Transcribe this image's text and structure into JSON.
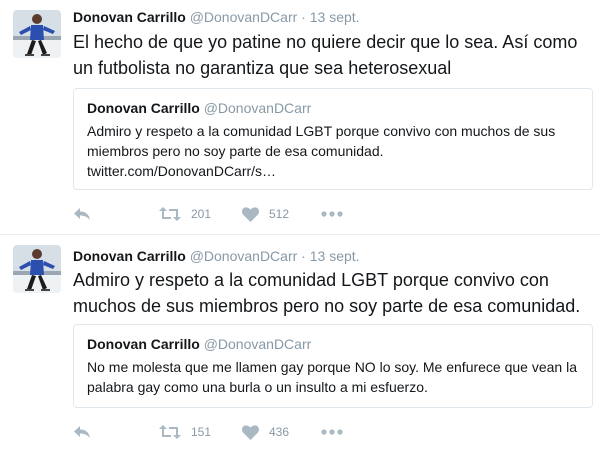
{
  "tweets": [
    {
      "name": "Donovan Carrillo",
      "handle": "@DonovanDCarr",
      "separator": "·",
      "time": "13 sept.",
      "text": "El hecho de que yo patine no quiere decir que lo sea. Así como un futbolista no garantiza que sea heterosexual",
      "quote": {
        "name": "Donovan Carrillo",
        "handle": "@DonovanDCarr",
        "text": "Admiro y respeto a la comunidad LGBT porque convivo con muchos de sus miembros pero no soy parte de esa comunidad.",
        "link": "twitter.com/DonovanDCarr/s…"
      },
      "retweets": "201",
      "likes": "512"
    },
    {
      "name": "Donovan Carrillo",
      "handle": "@DonovanDCarr",
      "separator": "·",
      "time": "13 sept.",
      "text": "Admiro y respeto a la comunidad LGBT porque convivo con muchos de sus miembros pero no soy parte de esa comunidad.",
      "quote": {
        "name": "Donovan Carrillo",
        "handle": "@DonovanDCarr",
        "text": "No me molesta que me llamen gay porque NO lo soy. Me enfurece que vean la palabra gay como una burla o un insulto a mi esfuerzo."
      },
      "retweets": "151",
      "likes": "436"
    }
  ],
  "colors": {
    "text": "#14171a",
    "secondary": "#8899a6",
    "icon": "#aab8c2",
    "border": "#e1e8ed",
    "divider": "#e6ecf0"
  },
  "icons": {
    "reply": "reply-icon",
    "retweet": "retweet-icon",
    "like": "heart-icon",
    "more": "more-icon"
  }
}
